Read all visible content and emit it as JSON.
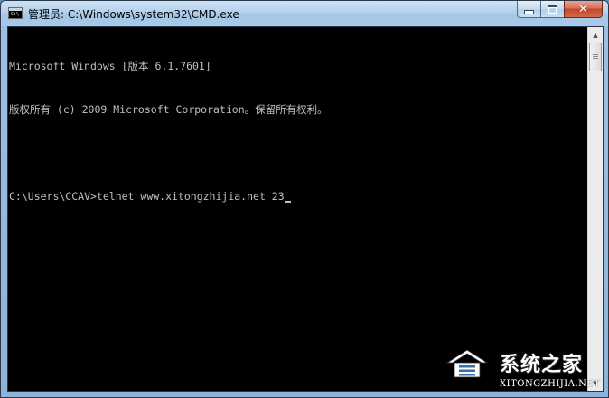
{
  "window": {
    "title": "管理员: C:\\Windows\\system32\\CMD.exe",
    "icon": "cmd-icon",
    "controls": {
      "minimize_icon": "minimize-icon",
      "maximize_icon": "maximize-icon",
      "close_icon": "close-icon",
      "close_glyph": "✕"
    },
    "accent_color": "#a5c6e6",
    "close_color": "#c4462a"
  },
  "console": {
    "background": "#000000",
    "foreground": "#c0c0c0",
    "lines": [
      "Microsoft Windows [版本 6.1.7601]",
      "版权所有 (c) 2009 Microsoft Corporation。保留所有权利。",
      "",
      "C:\\Users\\CCAV>telnet www.xitongzhijia.net 23"
    ]
  },
  "scrollbar": {
    "up_arrow": "▲",
    "down_arrow": "▼"
  },
  "watermark": {
    "brand": "系统之家",
    "url": "XITONGZHIJIA.NET"
  }
}
